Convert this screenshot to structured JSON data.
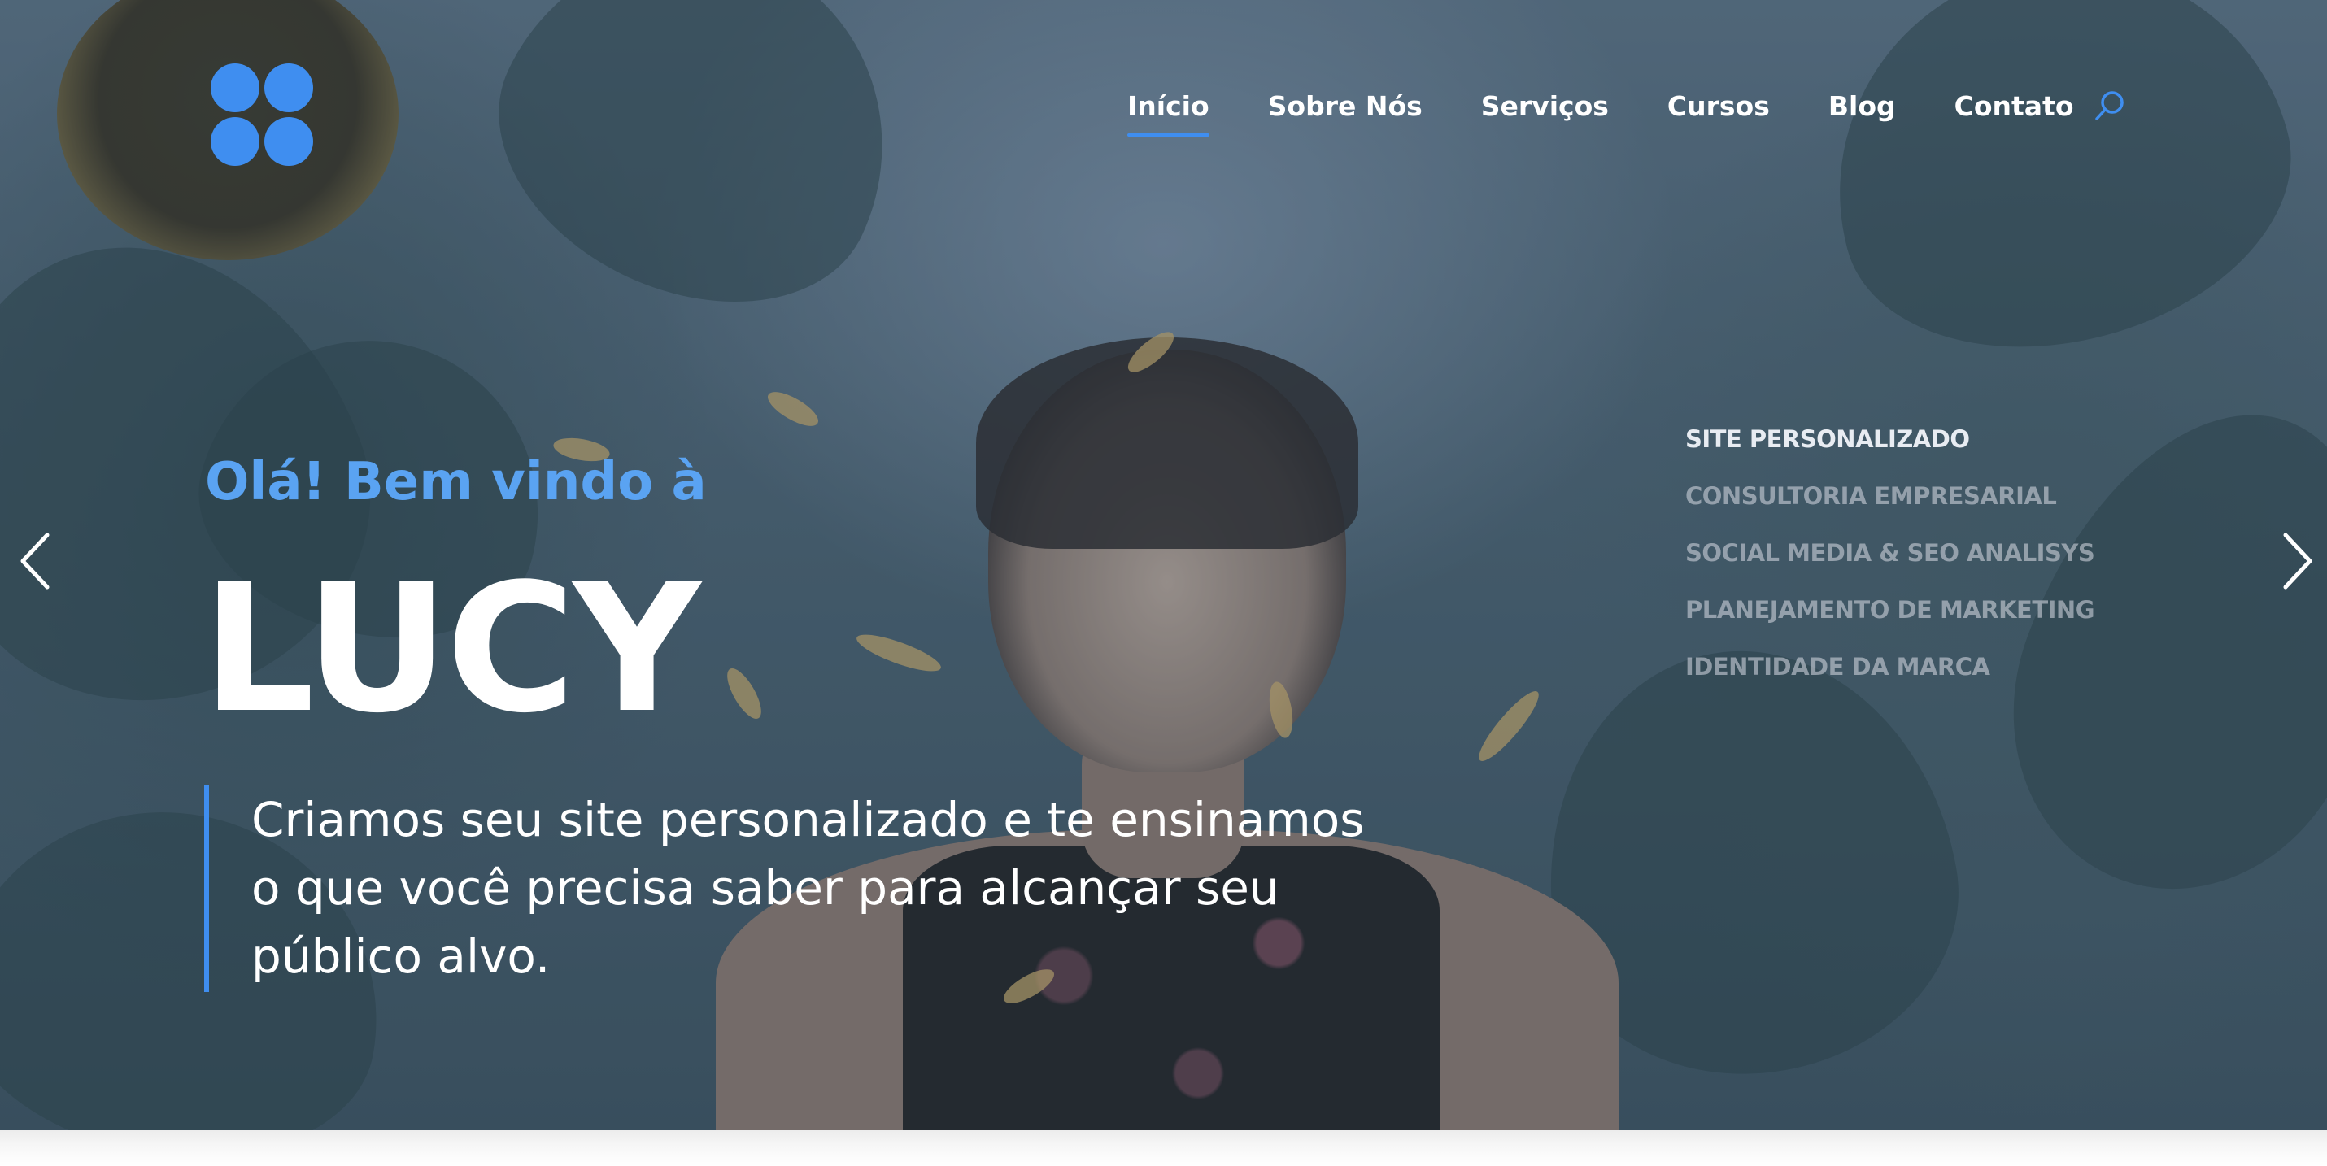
{
  "header": {
    "nav": [
      {
        "label": "Início",
        "active": true
      },
      {
        "label": "Sobre Nós",
        "active": false
      },
      {
        "label": "Serviços",
        "active": false
      },
      {
        "label": "Cursos",
        "active": false
      },
      {
        "label": "Blog",
        "active": false
      },
      {
        "label": "Contato",
        "active": false
      }
    ],
    "search_icon": "search-icon",
    "logo_icon": "four-circles-logo"
  },
  "hero": {
    "greeting": "Olá! Bem vindo à",
    "title": "LUCY",
    "tagline_lines": [
      "Criamos seu site personalizado e te ensinamos",
      "o que você precisa saber para alcançar seu",
      "público alvo."
    ],
    "services": [
      {
        "label": "SITE PERSONALIZADO",
        "active": true
      },
      {
        "label": "CONSULTORIA EMPRESARIAL",
        "active": false
      },
      {
        "label": "SOCIAL MEDIA & SEO ANALISYS",
        "active": false
      },
      {
        "label": "PLANEJAMENTO DE MARKETING",
        "active": false
      },
      {
        "label": "IDENTIDADE DA MARCA",
        "active": false
      }
    ],
    "prev_icon": "chevron-left-icon",
    "next_icon": "chevron-right-icon"
  },
  "colors": {
    "accent": "#3f8ef0",
    "greeting": "#5aa3f2",
    "text": "#ffffff"
  }
}
